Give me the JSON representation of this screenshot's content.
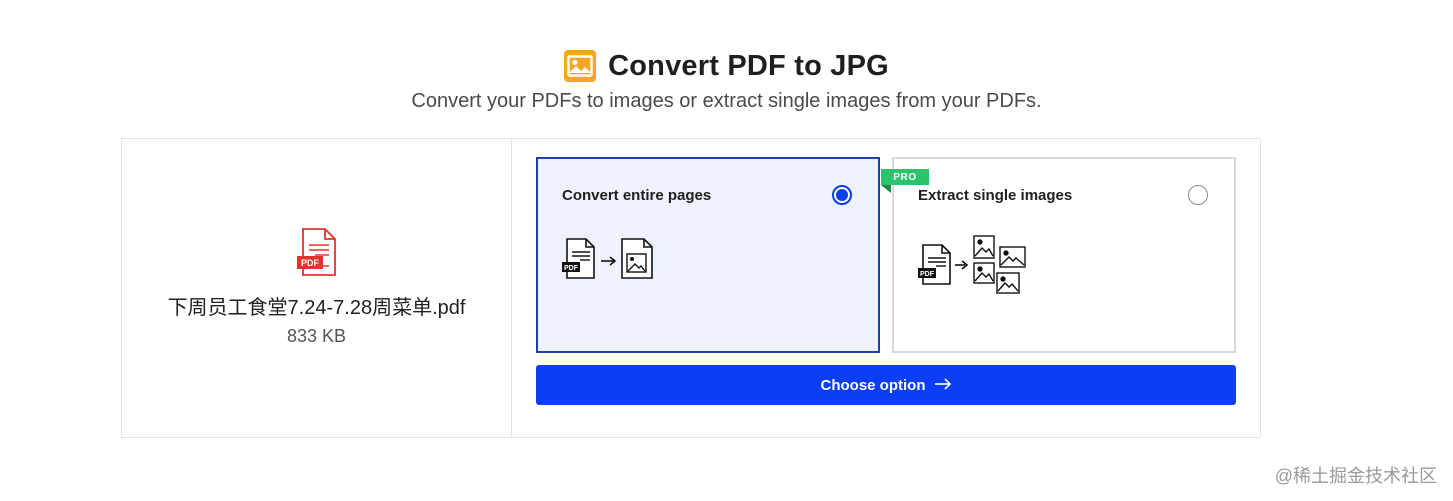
{
  "header": {
    "title": "Convert PDF to JPG",
    "subtitle": "Convert your PDFs to images or extract single images from your PDFs.",
    "icon": "image-icon",
    "icon_color": "#f5a623"
  },
  "file": {
    "icon": "pdf-file-icon",
    "icon_badge": "PDF",
    "name": "下周员工食堂7.24-7.28周菜单.pdf",
    "size": "833 KB"
  },
  "options": [
    {
      "label": "Convert entire pages",
      "selected": true,
      "icon": "pdf-to-page-icon"
    },
    {
      "label": "Extract single images",
      "selected": false,
      "badge": "PRO",
      "icon": "pdf-to-images-icon"
    }
  ],
  "choose_button": {
    "label": "Choose option",
    "icon": "arrow-right-icon"
  },
  "watermark": "@稀土掘金技术社区",
  "colors": {
    "accent": "#0b3ef5",
    "selected_border": "#1e3fae",
    "selected_bg": "#edf2fd",
    "pro_badge": "#2bc46a",
    "pdf_red": "#e0332f"
  }
}
